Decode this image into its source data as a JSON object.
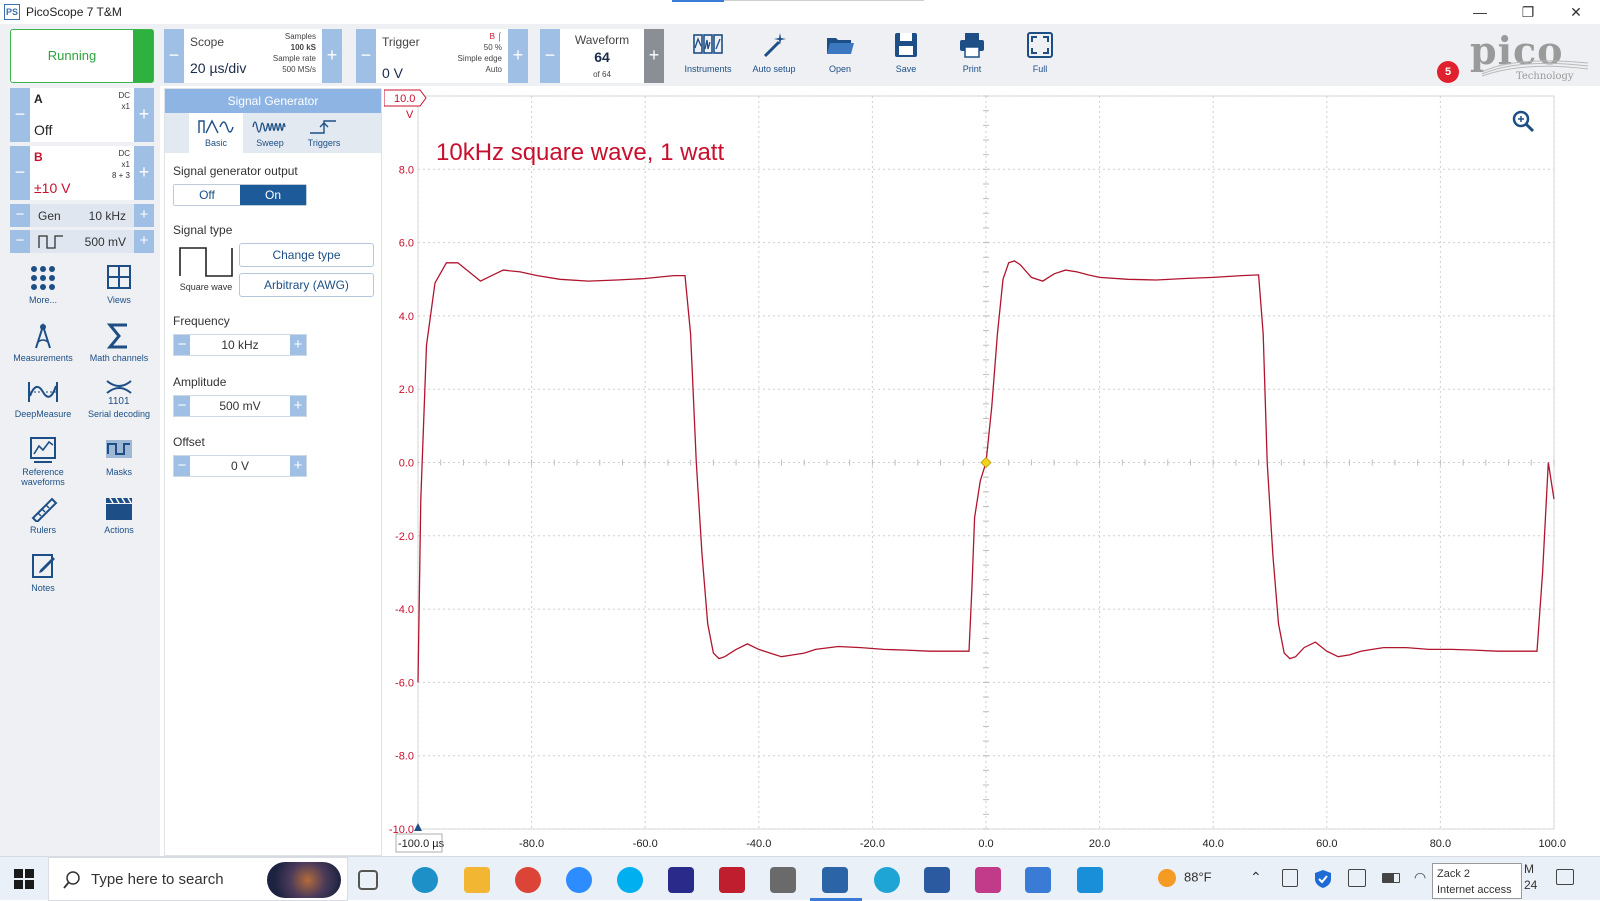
{
  "window": {
    "title": "PicoScope 7 T&M",
    "app_badge": "PS",
    "controls": [
      "—",
      "❐",
      "✕"
    ]
  },
  "toolbar": {
    "run_label": "Running",
    "scope": {
      "label": "Scope",
      "value": "20 µs/div",
      "samples_label": "Samples",
      "samples_value": "100 kS",
      "rate_label": "Sample rate",
      "rate_value": "500 MS/s"
    },
    "trigger": {
      "label": "Trigger",
      "value": "0 V",
      "channel": "B",
      "percent": "50 %",
      "type": "Simple edge",
      "mode": "Auto"
    },
    "waveform": {
      "label": "Waveform",
      "value": "64",
      "of": "of 64"
    },
    "tools": [
      {
        "label": "Instruments",
        "icon": "instruments-icon"
      },
      {
        "label": "Auto setup",
        "icon": "wand-icon"
      },
      {
        "label": "Open",
        "icon": "folder-icon"
      },
      {
        "label": "Save",
        "icon": "save-icon"
      },
      {
        "label": "Print",
        "icon": "print-icon"
      },
      {
        "label": "Full",
        "icon": "fullscreen-icon"
      }
    ],
    "notifications": "5",
    "brand": {
      "word": "pico",
      "sub": "Technology"
    }
  },
  "channels": [
    {
      "name": "A",
      "coupling": "DC",
      "probe": "x1",
      "extra": "",
      "value": "Off",
      "color": "#222222"
    },
    {
      "name": "B",
      "coupling": "DC",
      "probe": "x1",
      "extra": "8 + 3",
      "value": "±10 V",
      "color": "#c8102e"
    }
  ],
  "generator": {
    "label": "Gen",
    "frequency": "10 kHz",
    "amplitude": "500 mV"
  },
  "side_buttons": [
    {
      "label": "More...",
      "icon": "more-icon"
    },
    {
      "label": "Views",
      "icon": "views-icon"
    },
    {
      "label": "Measurements",
      "icon": "measurements-icon"
    },
    {
      "label": "Math channels",
      "icon": "sigma-icon"
    },
    {
      "label": "DeepMeasure",
      "icon": "deepmeasure-icon"
    },
    {
      "label": "Serial decoding",
      "icon": "serial-icon"
    },
    {
      "label": "Reference waveforms",
      "icon": "reference-icon"
    },
    {
      "label": "Masks",
      "icon": "masks-icon"
    },
    {
      "label": "Rulers",
      "icon": "ruler-icon"
    },
    {
      "label": "Actions",
      "icon": "actions-icon"
    },
    {
      "label": "Notes",
      "icon": "notes-icon"
    }
  ],
  "siggen": {
    "title": "Signal Generator",
    "tabs": [
      "Basic",
      "Sweep",
      "Triggers"
    ],
    "output_label": "Signal generator output",
    "off": "Off",
    "on": "On",
    "type_label": "Signal type",
    "wave_name": "Square wave",
    "change_type": "Change type",
    "awg": "Arbitrary (AWG)",
    "frequency_label": "Frequency",
    "frequency": "10 kHz",
    "amplitude_label": "Amplitude",
    "amplitude": "500 mV",
    "offset_label": "Offset",
    "offset": "0 V"
  },
  "chart_data": {
    "type": "line",
    "annotation": "10kHz square wave, 1 watt",
    "xunit": "µs",
    "yunit": "V",
    "xlim": [
      -100,
      100
    ],
    "ylim": [
      -10,
      10
    ],
    "x_ticks": [
      "-100.0",
      "-80.0",
      "-60.0",
      "-40.0",
      "-20.0",
      "0.0",
      "20.0",
      "40.0",
      "60.0",
      "80.0",
      "100.0"
    ],
    "y_ticks": [
      "10.0",
      "8.0",
      "6.0",
      "4.0",
      "2.0",
      "0.0",
      "-2.0",
      "-4.0",
      "-6.0",
      "-8.0",
      "-10.0"
    ],
    "grid": true,
    "series": [
      {
        "color": "#b0152f",
        "x": [
          -100,
          -99.5,
          -98.5,
          -97,
          -95,
          -93,
          -91,
          -89,
          -87,
          -85,
          -82,
          -79,
          -75,
          -70,
          -65,
          -60,
          -55,
          -53,
          -52,
          -51,
          -50,
          -49,
          -48,
          -47,
          -46,
          -44,
          -42,
          -40,
          -38,
          -36,
          -34,
          -32,
          -30,
          -26,
          -22,
          -18,
          -14,
          -10,
          -6,
          -3,
          -2.5,
          -2,
          -1,
          0,
          1,
          2,
          3,
          4,
          5,
          6,
          8,
          10,
          12,
          14,
          16,
          18,
          20,
          25,
          30,
          35,
          40,
          45,
          48,
          48.8,
          49.5,
          50.5,
          51.5,
          52.5,
          53.5,
          54.5,
          56,
          58,
          60,
          62,
          64,
          66,
          68,
          70,
          74,
          78,
          82,
          86,
          90,
          94,
          97,
          98,
          99,
          100
        ],
        "y": [
          -6.0,
          -1.0,
          3.2,
          4.9,
          5.45,
          5.45,
          5.2,
          4.95,
          5.1,
          5.25,
          5.2,
          5.1,
          5.0,
          4.95,
          4.98,
          5.02,
          5.1,
          5.1,
          3.5,
          0.0,
          -2.5,
          -4.4,
          -5.2,
          -5.35,
          -5.3,
          -5.1,
          -4.95,
          -5.1,
          -5.2,
          -5.3,
          -5.25,
          -5.2,
          -5.1,
          -5.02,
          -5.05,
          -5.1,
          -5.12,
          -5.15,
          -5.15,
          -5.15,
          -3.5,
          -1.5,
          -0.5,
          0.0,
          1.5,
          3.5,
          5.0,
          5.45,
          5.5,
          5.4,
          5.05,
          4.95,
          5.15,
          5.25,
          5.2,
          5.12,
          5.05,
          5.0,
          4.98,
          5.02,
          5.05,
          5.1,
          5.12,
          3.5,
          0.0,
          -2.5,
          -4.4,
          -5.2,
          -5.35,
          -5.3,
          -5.05,
          -4.9,
          -5.15,
          -5.3,
          -5.25,
          -5.15,
          -5.1,
          -5.05,
          -5.05,
          -5.1,
          -5.1,
          -5.12,
          -5.15,
          -5.15,
          -5.15,
          -3.0,
          0.0,
          -1.0
        ]
      }
    ],
    "trigger_marker": {
      "x": 0,
      "y": 0
    },
    "ref_arrow_label": "10.0",
    "ref_arrow_unit": "V",
    "x_origin_label": "-100.0 µs"
  },
  "taskbar": {
    "search_placeholder": "Type here to search",
    "weather": "88°F",
    "network_tooltip_1": "Zack 2",
    "network_tooltip_2": "Internet access",
    "clock_tail_1": "M",
    "clock_tail_2": "24",
    "apps": [
      "task-view-icon",
      "edge-icon",
      "explorer-icon",
      "chrome-icon",
      "zoom-icon",
      "skype-icon",
      "headphones-icon",
      "filezilla-icon",
      "calculator-icon",
      "picoscope-icon",
      "settings-app-icon",
      "network-analyzer-icon",
      "fra4ps-icon",
      "remote-desktop-icon",
      "store-icon"
    ]
  }
}
